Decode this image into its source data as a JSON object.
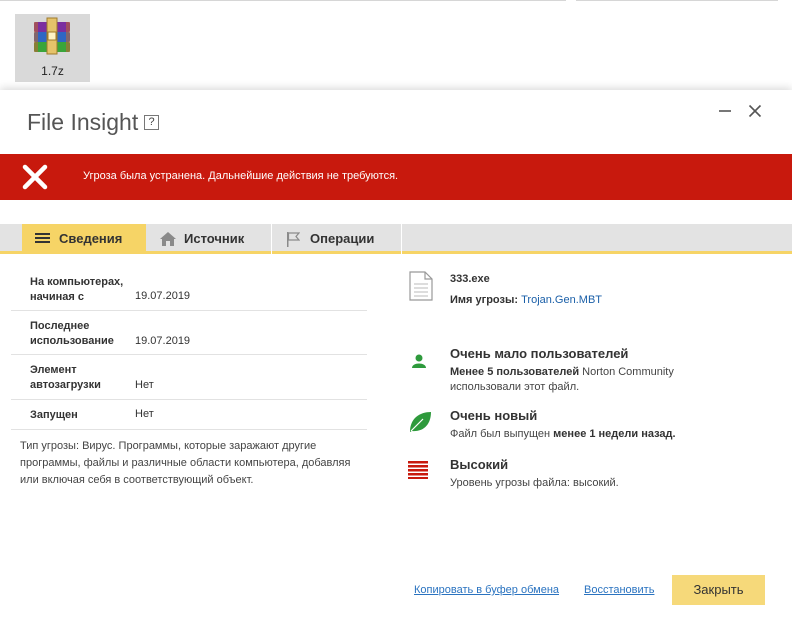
{
  "desktop": {
    "file_name": "1.7z",
    "file_icon": "winrar-archive-icon"
  },
  "dialog": {
    "title": "File Insight",
    "help_label": "?",
    "minimize_label": "—",
    "close_label": "✕"
  },
  "alert": {
    "text": "Угроза была устранена. Дальнейшие действия не требуются.",
    "color": "#c8190d"
  },
  "tabs": [
    {
      "label": "Сведения",
      "icon": "list-icon",
      "active": true
    },
    {
      "label": "Источник",
      "icon": "home-icon",
      "active": false
    },
    {
      "label": "Операции",
      "icon": "flag-icon",
      "active": false
    }
  ],
  "details": {
    "rows": [
      {
        "label_line1": "На компьютерах,",
        "label_line2": "начиная с",
        "value": "19.07.2019"
      },
      {
        "label_line1": "Последнее",
        "label_line2": "использование",
        "value": "19.07.2019"
      },
      {
        "label_line1": "Элемент",
        "label_line2": "автозагрузки",
        "value": "Нет"
      },
      {
        "label_line1": "Запущен",
        "label_line2": "",
        "value": "Нет"
      }
    ],
    "description_lines": [
      "Тип угрозы: Вирус. Программы, которые заражают другие",
      "программы, файлы и различные области компьютера, добавляя",
      "или включая себя в соответствующий объект."
    ]
  },
  "info": {
    "file": {
      "name": "333.exe",
      "threat_label": "Имя угрозы:",
      "threat_name": "Trojan.Gen.MBT"
    },
    "users": {
      "heading": "Очень мало пользователей",
      "bold_part": "Менее 5 пользователей",
      "text_after": " Norton Community",
      "line2": "использовали этот файл."
    },
    "age": {
      "heading": "Очень новый",
      "text_before": "Файл был выпущен ",
      "bold_part": "менее 1 недели назад."
    },
    "risk": {
      "heading": "Высокий",
      "text": "Уровень угрозы файла: высокий."
    }
  },
  "footer": {
    "copy_link": "Копировать в буфер обмена",
    "restore_link": "Восстановить",
    "close_button": "Закрыть"
  }
}
